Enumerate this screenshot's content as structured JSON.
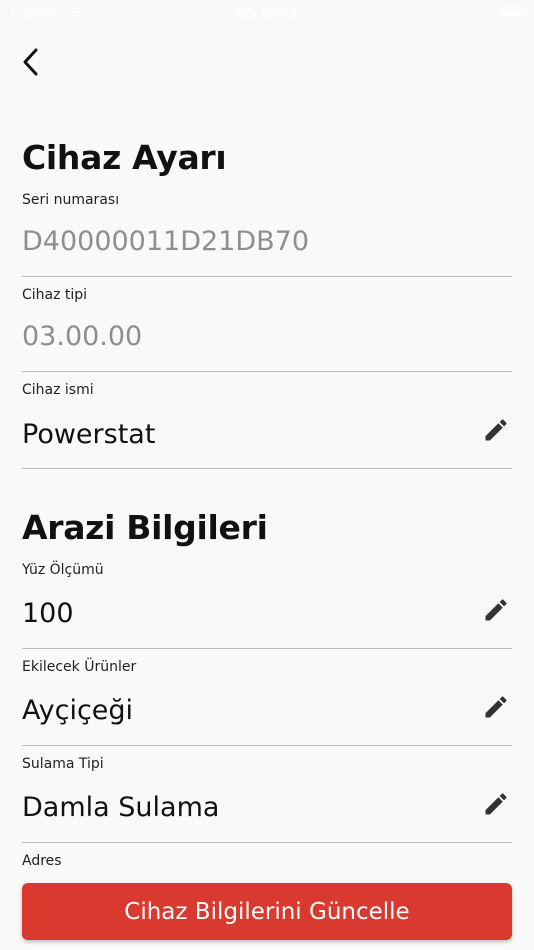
{
  "status_bar": {
    "carrier": "Carrier",
    "time": "05 8:02",
    "battery_level": 1.0
  },
  "nav": {
    "back_icon": "chevron-left-icon"
  },
  "device_section": {
    "title": "Cihaz Ayarı",
    "fields": [
      {
        "label": "Seri numarası",
        "value": "D40000011D21DB70",
        "editable": false
      },
      {
        "label": "Cihaz tipi",
        "value": "03.00.00",
        "editable": false
      },
      {
        "label": "Cihaz ismi",
        "value": "Powerstat",
        "editable": true
      }
    ]
  },
  "land_section": {
    "title": "Arazi Bilgileri",
    "fields": [
      {
        "label": "Yüz Ölçümü",
        "value": "100",
        "editable": true
      },
      {
        "label": "Ekilecek Ürünler",
        "value": "Ayçiçeği",
        "editable": true
      },
      {
        "label": "Sulama Tipi",
        "value": "Damla Sulama",
        "editable": true
      },
      {
        "label": "Adres",
        "value": "",
        "editable": true
      }
    ]
  },
  "actions": {
    "update_label": "Cihaz Bilgilerini Güncelle"
  },
  "colors": {
    "accent": "#d9392e",
    "background": "#f9f9f9",
    "readonly_text": "#8e8e8e",
    "divider": "#bdbdbd"
  }
}
